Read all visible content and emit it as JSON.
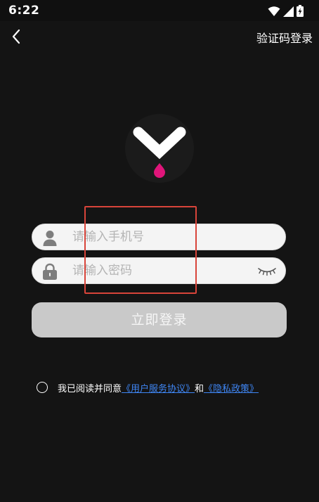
{
  "status_bar": {
    "time": "6:22",
    "icons": [
      "wifi-icon",
      "cellular-signal-icon",
      "battery-icon"
    ]
  },
  "nav": {
    "back_icon": "chevron-left-icon",
    "right_action": "验证码登录"
  },
  "logo": {
    "icon": "app-logo-icon",
    "accent_color": "#e0157a"
  },
  "form": {
    "phone": {
      "icon": "user-icon",
      "placeholder": "请输入手机号",
      "value": ""
    },
    "password": {
      "icon": "lock-icon",
      "placeholder": "请输入密码",
      "value": "",
      "toggle_icon": "eye-closed-icon"
    },
    "submit_label": "立即登录"
  },
  "agreement": {
    "checked": false,
    "prefix": "我已阅读并同意",
    "user_agreement": "《用户服务协议》",
    "conjunction": "和",
    "privacy_policy": "《隐私政策》"
  },
  "colors": {
    "background": "#141414",
    "button_disabled": "#c9c9c9",
    "link": "#3f86f4",
    "highlight": "#d8443a"
  }
}
